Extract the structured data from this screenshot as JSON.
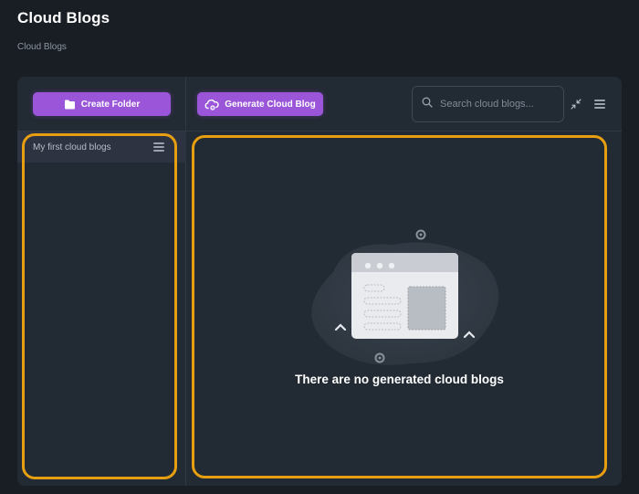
{
  "header": {
    "title": "Cloud Blogs",
    "breadcrumb": "Cloud Blogs"
  },
  "sidebar": {
    "create_folder_label": "Create Folder",
    "folders": [
      {
        "label": "My first cloud blogs"
      }
    ]
  },
  "toolbar": {
    "generate_label": "Generate Cloud Blog",
    "search_placeholder": "Search cloud blogs..."
  },
  "main": {
    "empty_message": "There are no generated cloud blogs"
  },
  "icons": {
    "create_folder": "folder-icon",
    "generate": "cloud-gear-icon",
    "search": "search-icon",
    "collapse": "collapse-arrows-icon",
    "menu": "hamburger-menu-icon"
  },
  "colors": {
    "accent": "#9a55d9",
    "highlight": "#e79f12",
    "background": "#191e25",
    "card": "#222a33"
  }
}
